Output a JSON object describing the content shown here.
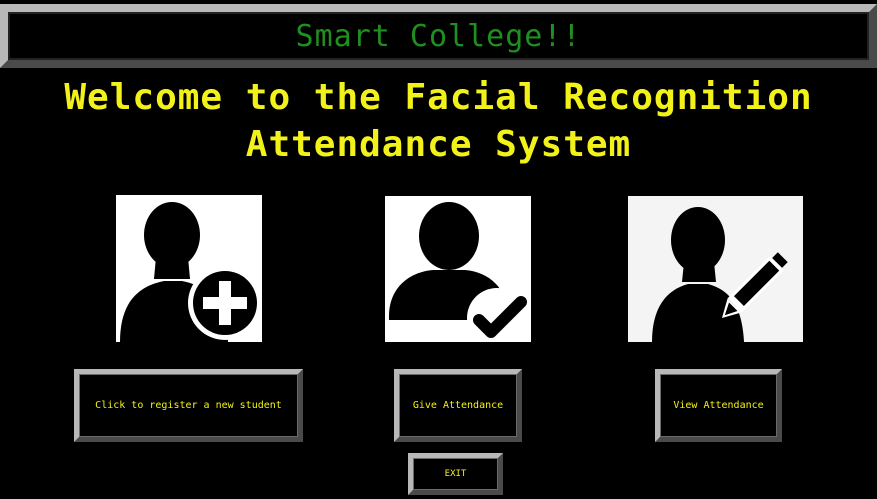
{
  "header": {
    "title": "Smart College!!"
  },
  "welcome": {
    "line1": "Welcome to the Facial Recognition",
    "line2": "Attendance System"
  },
  "icons": {
    "register": "user-add-icon",
    "give": "user-check-icon",
    "view": "user-edit-icon"
  },
  "buttons": {
    "register": "Click to register a new student",
    "give": "Give Attendance",
    "view": "View Attendance",
    "exit": "EXIT"
  },
  "colors": {
    "background": "#000000",
    "title_text": "#1f8f1f",
    "welcome_text": "#f2f21a",
    "button_text": "#f2f21a",
    "bevel_light": "#b8b8b8",
    "bevel_dark": "#4a4a4a"
  }
}
